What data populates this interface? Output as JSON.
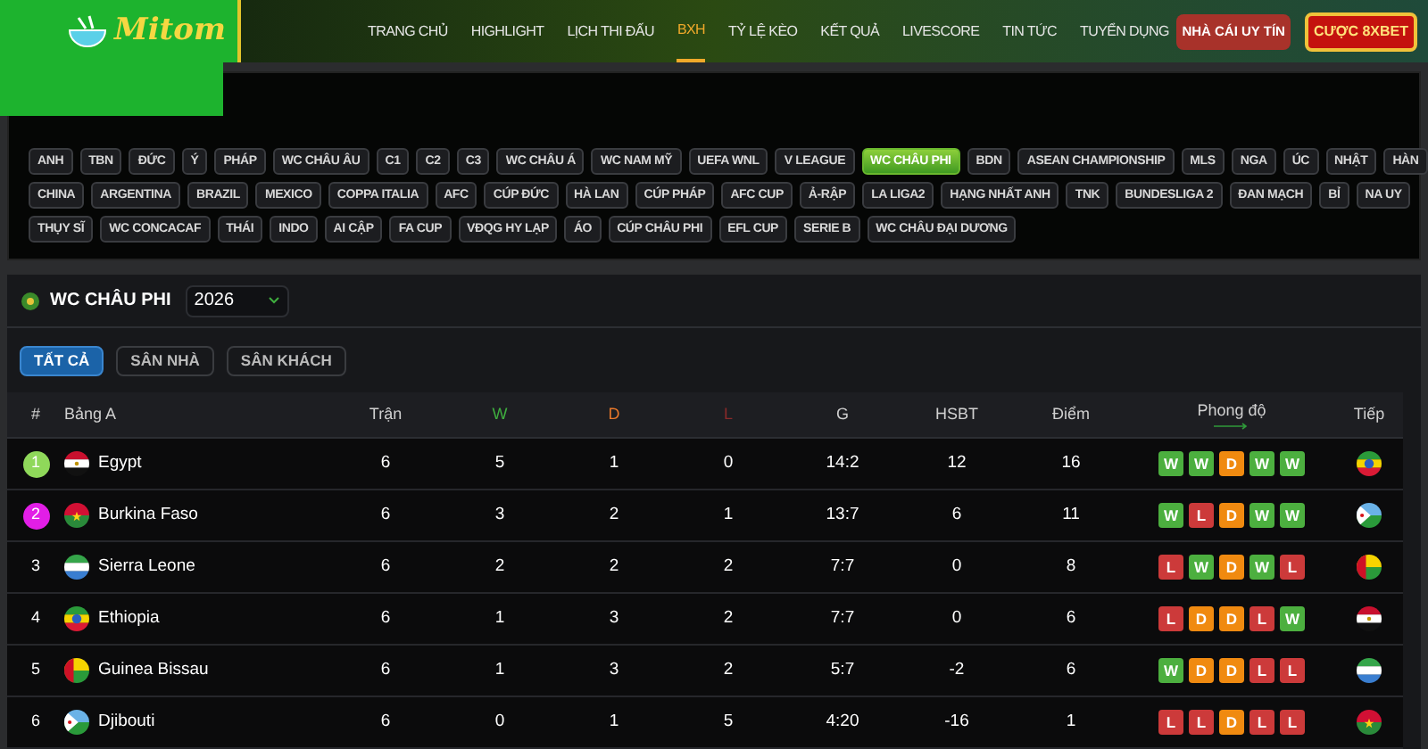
{
  "header": {
    "logo": "Mitom",
    "nav": [
      {
        "label": "TRANG CHỦ",
        "selected": false
      },
      {
        "label": "HIGHLIGHT",
        "selected": false
      },
      {
        "label": "LỊCH THI ĐẤU",
        "selected": false
      },
      {
        "label": "BXH",
        "selected": true
      },
      {
        "label": "TỶ LỆ KÈO",
        "selected": false
      },
      {
        "label": "KẾT QUẢ",
        "selected": false
      },
      {
        "label": "LIVESCORE",
        "selected": false
      },
      {
        "label": "TIN TỨC",
        "selected": false
      },
      {
        "label": "TUYỂN DỤNG",
        "selected": false
      }
    ],
    "buttons": [
      "NHÀ CÁI UY TÍN",
      "CƯỢC 8XBET"
    ]
  },
  "league_chips": [
    [
      {
        "label": "ANH",
        "selected": false
      },
      {
        "label": "TBN",
        "selected": false
      },
      {
        "label": "ĐỨC",
        "selected": false
      },
      {
        "label": "Ý",
        "selected": false
      },
      {
        "label": "PHÁP",
        "selected": false
      },
      {
        "label": "WC CHÂU ÂU",
        "selected": false
      },
      {
        "label": "C1",
        "selected": false
      },
      {
        "label": "C2",
        "selected": false
      },
      {
        "label": "C3",
        "selected": false
      },
      {
        "label": "WC CHÂU Á",
        "selected": false
      },
      {
        "label": "WC NAM MỸ",
        "selected": false
      },
      {
        "label": "UEFA WNL",
        "selected": false
      },
      {
        "label": "V LEAGUE",
        "selected": false
      },
      {
        "label": "WC CHÂU PHI",
        "selected": true
      },
      {
        "label": "BDN",
        "selected": false
      },
      {
        "label": "ASEAN CHAMPIONSHIP",
        "selected": false
      },
      {
        "label": "MLS",
        "selected": false
      },
      {
        "label": "NGA",
        "selected": false
      },
      {
        "label": "ÚC",
        "selected": false
      },
      {
        "label": "NHẬT",
        "selected": false
      },
      {
        "label": "HÀN",
        "selected": false
      }
    ],
    [
      {
        "label": "CHINA",
        "selected": false
      },
      {
        "label": "ARGENTINA",
        "selected": false
      },
      {
        "label": "BRAZIL",
        "selected": false
      },
      {
        "label": "MEXICO",
        "selected": false
      },
      {
        "label": "COPPA ITALIA",
        "selected": false
      },
      {
        "label": "AFC",
        "selected": false
      },
      {
        "label": "CÚP ĐỨC",
        "selected": false
      },
      {
        "label": "HÀ LAN",
        "selected": false
      },
      {
        "label": "CÚP PHÁP",
        "selected": false
      },
      {
        "label": "AFC CUP",
        "selected": false
      },
      {
        "label": "Ả-RẬP",
        "selected": false
      },
      {
        "label": "LA LIGA2",
        "selected": false
      },
      {
        "label": "HẠNG NHẤT ANH",
        "selected": false
      },
      {
        "label": "TNK",
        "selected": false
      },
      {
        "label": "BUNDESLIGA 2",
        "selected": false
      },
      {
        "label": "ĐAN MẠCH",
        "selected": false
      },
      {
        "label": "BỈ",
        "selected": false
      },
      {
        "label": "NA UY",
        "selected": false
      }
    ],
    [
      {
        "label": "THỤY SĨ",
        "selected": false
      },
      {
        "label": "WC CONCACAF",
        "selected": false
      },
      {
        "label": "THÁI",
        "selected": false
      },
      {
        "label": "INDO",
        "selected": false
      },
      {
        "label": "AI CẬP",
        "selected": false
      },
      {
        "label": "FA CUP",
        "selected": false
      },
      {
        "label": "VĐQG HY LẠP",
        "selected": false
      },
      {
        "label": "ÁO",
        "selected": false
      },
      {
        "label": "CÚP CHÂU PHI",
        "selected": false
      },
      {
        "label": "EFL CUP",
        "selected": false
      },
      {
        "label": "SERIE B",
        "selected": false
      },
      {
        "label": "WC CHÂU ĐẠI DƯƠNG",
        "selected": false
      }
    ]
  ],
  "standings": {
    "title": "WC CHÂU PHI",
    "season": "2026",
    "filters": [
      {
        "label": "TẤT CẢ",
        "selected": true
      },
      {
        "label": "SÂN NHÀ",
        "selected": false
      },
      {
        "label": "SÂN KHÁCH",
        "selected": false
      }
    ],
    "columns": [
      {
        "label": "#"
      },
      {
        "label": "Bảng A"
      },
      {
        "label": "Trận"
      },
      {
        "label": "W",
        "color": "#3fae3f"
      },
      {
        "label": "D",
        "color": "#e8782a"
      },
      {
        "label": "L",
        "color": "#8a2a2a"
      },
      {
        "label": "G"
      },
      {
        "label": "HSBT"
      },
      {
        "label": "Điểm"
      },
      {
        "label": "Phong độ"
      },
      {
        "label": "Tiếp"
      }
    ],
    "rows": [
      {
        "rank": "1",
        "color": "#8fd85a",
        "team": "Egypt",
        "played": "6",
        "w": "5",
        "d": "1",
        "l": "0",
        "goals": "14:2",
        "diff": "12",
        "points": "16",
        "form": [
          {
            "result": "W",
            "kind": "win"
          },
          {
            "result": "W",
            "kind": "win"
          },
          {
            "result": "D",
            "kind": "draw"
          },
          {
            "result": "W",
            "kind": "win"
          },
          {
            "result": "W",
            "kind": "win"
          }
        ]
      },
      {
        "rank": "2",
        "color": "#e21ee6",
        "team": "Burkina Faso",
        "played": "6",
        "w": "3",
        "d": "2",
        "l": "1",
        "goals": "13:7",
        "diff": "6",
        "points": "11",
        "form": [
          {
            "result": "W",
            "kind": "win"
          },
          {
            "result": "L",
            "kind": "loss"
          },
          {
            "result": "D",
            "kind": "draw"
          },
          {
            "result": "W",
            "kind": "win"
          },
          {
            "result": "W",
            "kind": "win"
          }
        ]
      },
      {
        "rank": "3",
        "team": "Sierra Leone",
        "played": "6",
        "w": "2",
        "d": "2",
        "l": "2",
        "goals": "7:7",
        "diff": "0",
        "points": "8",
        "form": [
          {
            "result": "L",
            "kind": "loss"
          },
          {
            "result": "W",
            "kind": "win"
          },
          {
            "result": "D",
            "kind": "draw"
          },
          {
            "result": "W",
            "kind": "win"
          },
          {
            "result": "L",
            "kind": "loss"
          }
        ]
      },
      {
        "rank": "4",
        "team": "Ethiopia",
        "played": "6",
        "w": "1",
        "d": "3",
        "l": "2",
        "goals": "7:7",
        "diff": "0",
        "points": "6",
        "form": [
          {
            "result": "L",
            "kind": "loss"
          },
          {
            "result": "D",
            "kind": "draw"
          },
          {
            "result": "D",
            "kind": "draw"
          },
          {
            "result": "L",
            "kind": "loss"
          },
          {
            "result": "W",
            "kind": "win"
          }
        ]
      },
      {
        "rank": "5",
        "team": "Guinea Bissau",
        "played": "6",
        "w": "1",
        "d": "3",
        "l": "2",
        "goals": "5:7",
        "diff": "-2",
        "points": "6",
        "form": [
          {
            "result": "W",
            "kind": "win"
          },
          {
            "result": "D",
            "kind": "draw"
          },
          {
            "result": "D",
            "kind": "draw"
          },
          {
            "result": "L",
            "kind": "loss"
          },
          {
            "result": "L",
            "kind": "loss"
          }
        ]
      },
      {
        "rank": "6",
        "team": "Djibouti",
        "played": "6",
        "w": "0",
        "d": "1",
        "l": "5",
        "goals": "4:20",
        "diff": "-16",
        "points": "1",
        "form": [
          {
            "result": "L",
            "kind": "loss"
          },
          {
            "result": "L",
            "kind": "loss"
          },
          {
            "result": "D",
            "kind": "draw"
          },
          {
            "result": "L",
            "kind": "loss"
          },
          {
            "result": "L",
            "kind": "loss"
          }
        ]
      }
    ]
  }
}
